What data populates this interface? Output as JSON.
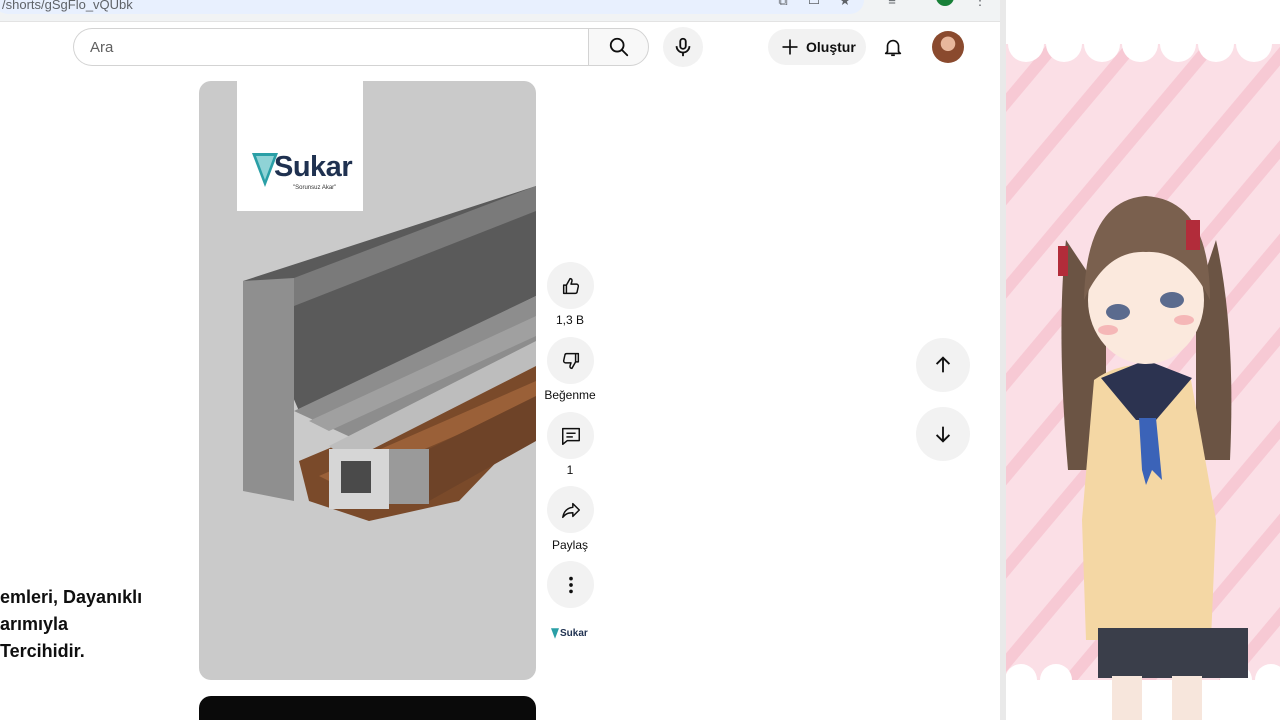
{
  "browser": {
    "url_fragment": "/shorts/gSgFlo_vQUbk"
  },
  "header": {
    "search_placeholder": "Ara",
    "create_label": "Oluştur"
  },
  "video": {
    "brand": "Sukar",
    "brand_tagline": "\"Sorunsuz Akar\"",
    "title_lines": [
      "emleri, Dayanıklı",
      "arımıyla",
      "Tercihidir."
    ],
    "channel_name": "Sukar"
  },
  "actions": {
    "like_count": "1,3 B",
    "dislike_label": "Beğenme",
    "comment_count": "1",
    "share_label": "Paylaş"
  },
  "colors": {
    "brand_navy": "#1f3150",
    "brand_teal": "#2a9fa6",
    "panel_pink": "#fbdfe6"
  }
}
